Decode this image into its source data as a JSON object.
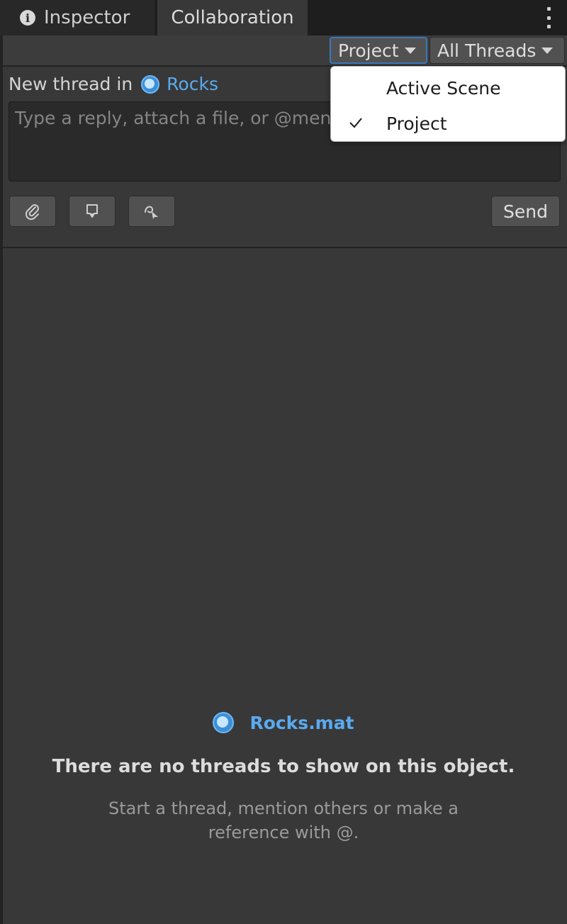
{
  "tabs": {
    "inspector_label": "Inspector",
    "collaboration_label": "Collaboration"
  },
  "toolbar": {
    "scope_value": "Project",
    "filter_value": "All Threads"
  },
  "scope_menu": {
    "items": [
      {
        "label": "Active Scene",
        "checked": false
      },
      {
        "label": "Project",
        "checked": true
      }
    ]
  },
  "composer": {
    "prefix": "New thread in",
    "target": "Rocks",
    "placeholder": "Type a reply, attach a file, or @mention",
    "send_label": "Send",
    "tool_icons": [
      "paperclip-icon",
      "comment-marker-icon",
      "draw-arrow-icon"
    ]
  },
  "empty_state": {
    "object_name": "Rocks.mat",
    "title": "There are no threads to show on this object.",
    "subtitle": "Start a thread, mention others or make a reference with @."
  },
  "colors": {
    "accent_link": "#5aaaf0",
    "focus_border": "#3a79bb",
    "panel_bg": "#383838"
  }
}
